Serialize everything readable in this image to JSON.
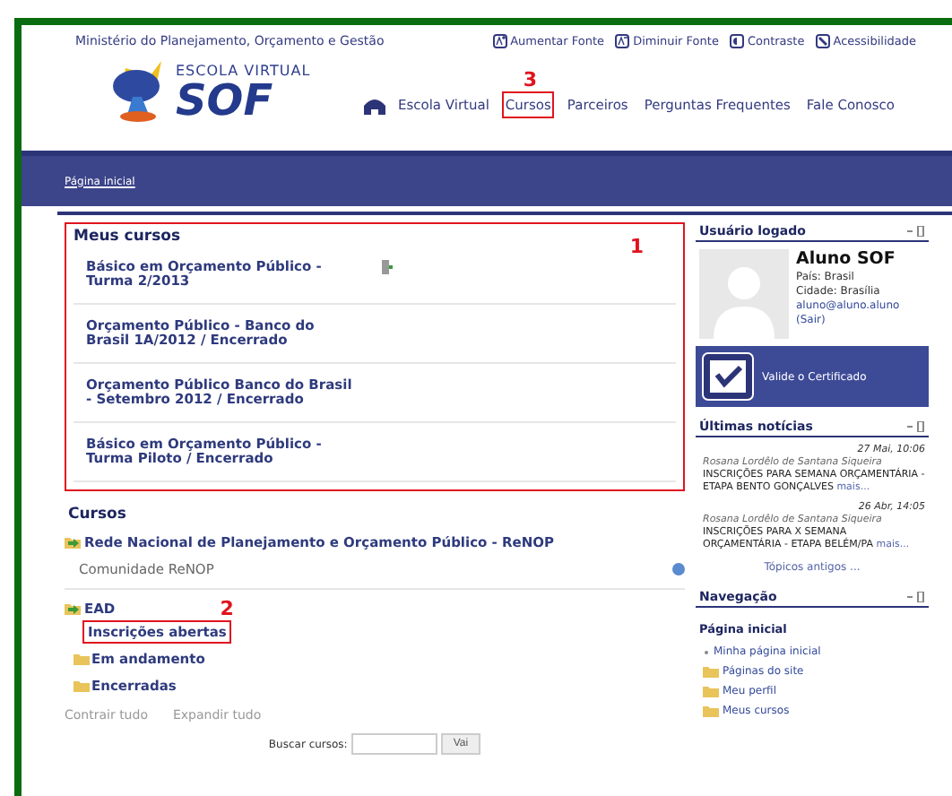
{
  "header": {
    "ministry": "Ministério do Planejamento, Orçamento e Gestão",
    "tools": [
      {
        "kind": "plus",
        "label": "Aumentar Fonte"
      },
      {
        "kind": "minus",
        "label": "Diminuir Fonte"
      },
      {
        "kind": "contrast",
        "label": "Contraste"
      },
      {
        "kind": "access",
        "label": "Acessibilidade"
      }
    ],
    "logo": {
      "top": "ESCOLA VIRTUAL",
      "main": "SOF"
    },
    "nav": [
      {
        "label": "Escola Virtual",
        "highlighted": false
      },
      {
        "label": "Cursos",
        "highlighted": true,
        "callout": "3"
      },
      {
        "label": "Parceiros",
        "highlighted": false
      },
      {
        "label": "Perguntas Frequentes",
        "highlighted": false
      },
      {
        "label": "Fale Conosco",
        "highlighted": false
      }
    ]
  },
  "breadcrumb": "Página inicial",
  "my_courses": {
    "title": "Meus cursos",
    "highlighted": true,
    "callout": "1",
    "courses": [
      {
        "title": "Básico em Orçamento Público - Turma 2/2013",
        "icon": true
      },
      {
        "title": "Orçamento Público - Banco do Brasil 1A/2012 / Encerrado",
        "icon": false
      },
      {
        "title": "Orçamento Público Banco do Brasil - Setembro 2012 / Encerrado",
        "icon": false
      },
      {
        "title": "Básico em Orçamento Público - Turma Piloto / Encerrado",
        "icon": false
      }
    ]
  },
  "courses": {
    "title": "Cursos",
    "categories": [
      {
        "label": "Rede Nacional de Planejamento e Orçamento Público - ReNOP",
        "kind": "expanded",
        "children": [
          {
            "label": "Comunidade ReNOP",
            "kind": "course"
          }
        ]
      },
      {
        "label": "EAD",
        "kind": "expanded",
        "children": [
          {
            "label": "Inscrições abertas",
            "kind": "plain",
            "highlighted": true,
            "callout": "2"
          },
          {
            "label": "Em andamento",
            "kind": "folder",
            "highlighted": false
          },
          {
            "label": "Encerradas",
            "kind": "folder",
            "highlighted": false
          }
        ]
      }
    ],
    "collapse": "Contrair tudo",
    "expand": "Expandir tudo",
    "search_label": "Buscar cursos:",
    "search_button": "Vai"
  },
  "user": {
    "title": "Usuário logado",
    "name": "Aluno SOF",
    "country": "País: Brasil",
    "city": "Cidade: Brasília",
    "email": "aluno@aluno.aluno",
    "logout": "(Sair)",
    "certificate": "Valide o Certificado"
  },
  "news": {
    "title": "Últimas notícias",
    "items": [
      {
        "date": "27 Mai, 10:06",
        "author": "Rosana Lordêlo de Santana Siqueira",
        "text": "INSCRIÇÕES PARA SEMANA ORÇAMENTÁRIA - ETAPA BENTO GONÇALVES",
        "more": "mais..."
      },
      {
        "date": "26 Abr, 14:05",
        "author": "Rosana Lordêlo de Santana Siqueira",
        "text": "INSCRIÇÕES PARA X SEMANA ORÇAMENTÁRIA - ETAPA BELÉM/PA",
        "more": "mais..."
      }
    ],
    "older": "Tópicos antigos ..."
  },
  "navigation": {
    "title": "Navegação",
    "home": "Página inicial",
    "items": [
      {
        "label": "Minha página inicial",
        "kind": "bullet"
      },
      {
        "label": "Páginas do site",
        "kind": "folder"
      },
      {
        "label": "Meu perfil",
        "kind": "folder"
      },
      {
        "label": "Meus cursos",
        "kind": "folder"
      }
    ]
  }
}
